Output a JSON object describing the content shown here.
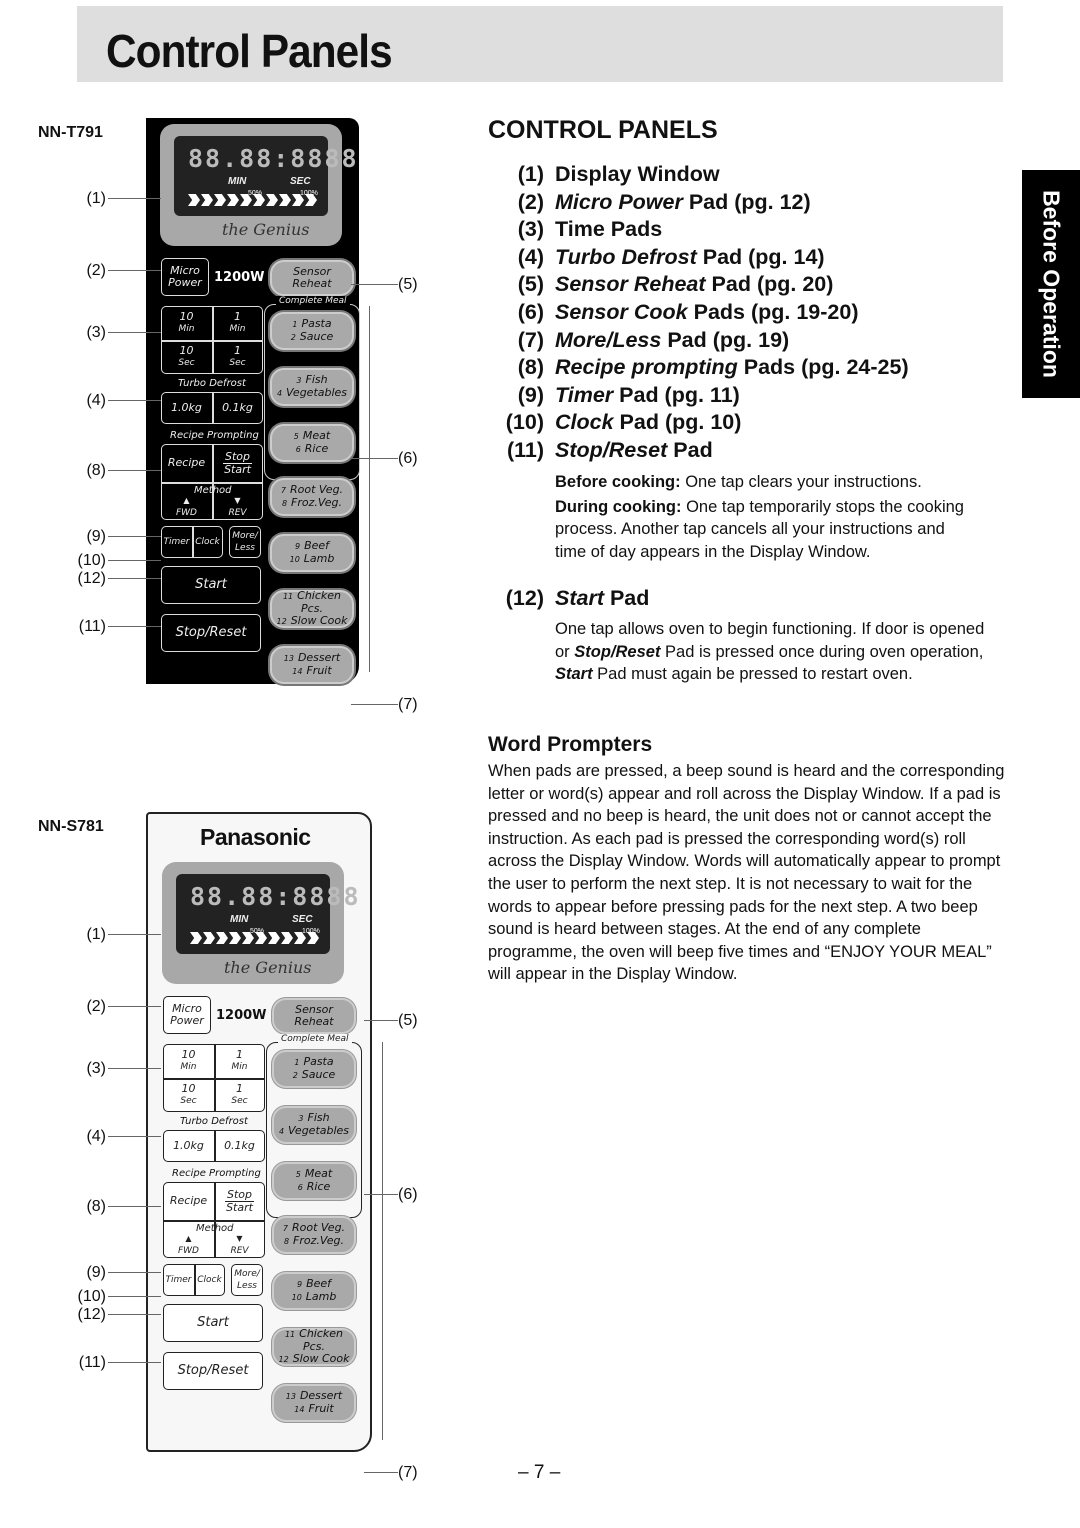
{
  "page": {
    "title": "Control Panels",
    "side_tab": "Before Operation",
    "page_number": "– 7 –"
  },
  "panel_top": {
    "model": "NN-T791",
    "display": {
      "segments": "88.88:8888",
      "min": "MIN",
      "sec": "SEC",
      "pct50": "50%",
      "pct100": "100%",
      "logo": "the Genius"
    },
    "micro_power": [
      "Micro",
      "Power"
    ],
    "wattage": "1200W",
    "sensor_reheat": [
      "Sensor",
      "Reheat"
    ],
    "complete_meal": "Complete Meal",
    "time_pads": [
      {
        "value": "10",
        "unit": "Min"
      },
      {
        "value": "1",
        "unit": "Min"
      },
      {
        "value": "10",
        "unit": "Sec"
      },
      {
        "value": "1",
        "unit": "Sec"
      }
    ],
    "turbo_defrost_label": "Turbo Defrost",
    "defrost_pads": [
      "1.0kg",
      "0.1kg"
    ],
    "recipe_prompting_label": "Recipe Prompting",
    "recipe": "Recipe",
    "stop": "Stop",
    "start_small": "Start",
    "method": "Method",
    "fwd": "FWD",
    "rev": "REV",
    "timer": "Timer",
    "clock": "Clock",
    "more_less": [
      "More/",
      "Less"
    ],
    "start": "Start",
    "stop_reset": "Stop/Reset",
    "sensor_pads": [
      {
        "n1": "1",
        "l1": "Pasta",
        "n2": "2",
        "l2": "Sauce"
      },
      {
        "n1": "3",
        "l1": "Fish",
        "n2": "4",
        "l2": "Vegetables"
      },
      {
        "n1": "5",
        "l1": "Meat",
        "n2": "6",
        "l2": "Rice"
      },
      {
        "n1": "7",
        "l1": "Root Veg.",
        "n2": "8",
        "l2": "Froz.Veg."
      },
      {
        "n1": "9",
        "l1": "Beef",
        "n2": "10",
        "l2": "Lamb"
      },
      {
        "n1": "11",
        "l1": "Chicken Pcs.",
        "n2": "12",
        "l2": "Slow Cook"
      },
      {
        "n1": "13",
        "l1": "Dessert",
        "n2": "14",
        "l2": "Fruit"
      }
    ],
    "callouts": [
      "(1)",
      "(2)",
      "(3)",
      "(4)",
      "(8)",
      "(9)",
      "(10)",
      "(12)",
      "(11)",
      "(5)",
      "(6)",
      "(7)"
    ]
  },
  "panel_bottom": {
    "model": "NN-S781",
    "brand": "Panasonic",
    "callouts": [
      "(1)",
      "(2)",
      "(3)",
      "(4)",
      "(8)",
      "(9)",
      "(10)",
      "(12)",
      "(11)",
      "(5)",
      "(6)",
      "(7)"
    ]
  },
  "control_panels": {
    "heading": "CONTROL PANELS",
    "items": [
      {
        "num": "(1)",
        "italic": "",
        "rest": "Display Window"
      },
      {
        "num": "(2)",
        "italic": "Micro Power",
        "rest": " Pad (pg. 12)"
      },
      {
        "num": "(3)",
        "italic": "",
        "rest": "Time Pads"
      },
      {
        "num": "(4)",
        "italic": "Turbo Defrost",
        "rest": " Pad (pg. 14)"
      },
      {
        "num": "(5)",
        "italic": "Sensor Reheat",
        "rest": " Pad (pg. 20)"
      },
      {
        "num": "(6)",
        "italic": "Sensor Cook",
        "rest": " Pads (pg. 19-20)"
      },
      {
        "num": "(7)",
        "italic": "More/Less",
        "rest": " Pad (pg. 19)"
      },
      {
        "num": "(8)",
        "italic": "Recipe prompting",
        "rest": " Pads (pg. 24-25)"
      },
      {
        "num": "(9)",
        "italic": "Timer",
        "rest": " Pad (pg. 11)"
      },
      {
        "num": "(10)",
        "italic": "Clock",
        "rest": " Pad (pg. 10)"
      },
      {
        "num": "(11)",
        "italic": "Stop/Reset",
        "rest": " Pad"
      }
    ],
    "stop_reset_desc": {
      "before_label": "Before cooking:",
      "before_text": " One tap clears your instructions.",
      "during_label": "During cooking:",
      "during_text": " One tap temporarily stops the cooking process. Another tap cancels all your instructions and time of day appears in the Display Window."
    },
    "item12": {
      "num": "(12)",
      "italic": "Start",
      "rest": " Pad"
    },
    "start_desc": {
      "t1": "One tap allows oven to begin functioning. If door is opened or ",
      "b1": "Stop/Reset",
      "t2": " Pad is pressed once during oven operation, ",
      "b2": "Start",
      "t3": " Pad must again be pressed to restart oven."
    }
  },
  "word_prompters": {
    "heading": "Word Prompters",
    "body": "When pads are pressed, a beep sound is heard and the corresponding letter or word(s) appear and roll across the Display Window. If a pad is pressed and no beep is heard, the unit does not or cannot accept the instruction. As each pad is pressed the corresponding word(s) roll across the Display Window. Words will automatically appear to prompt the user to perform the next step. It is not necessary to wait for the words to appear before pressing pads for the next step. A two beep sound is heard between stages. At the end of any complete programme, the oven will beep five times and “ENJOY YOUR MEAL” will appear in the Display Window."
  }
}
